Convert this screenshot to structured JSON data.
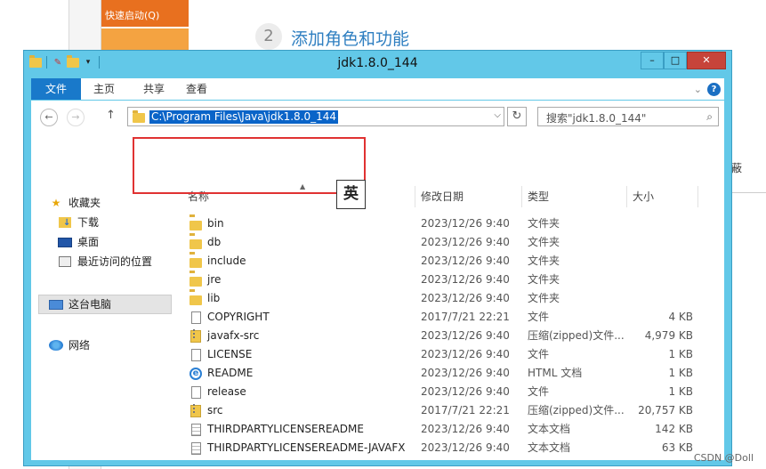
{
  "background": {
    "orange_menu": "快速启动(Q)",
    "step_number": "2",
    "step_text": "添加角色和功能",
    "right_char": "蔽",
    "watermark": "CSDN @Doll"
  },
  "window": {
    "title": "jdk1.8.0_144",
    "minimize": "–",
    "maximize": "□",
    "close": "✕"
  },
  "ribbon": {
    "tabs": [
      "文件",
      "主页",
      "共享",
      "查看"
    ],
    "help": "?"
  },
  "address": {
    "path": "C:\\Program Files\\Java\\jdk1.8.0_144",
    "search_placeholder": "搜索\"jdk1.8.0_144\""
  },
  "ime_indicator": "英",
  "nav_pane": {
    "favorites": "收藏夹",
    "downloads": "下载",
    "desktop": "桌面",
    "recent": "最近访问的位置",
    "this_pc": "这台电脑",
    "network": "网络"
  },
  "columns": {
    "name": "名称",
    "date": "修改日期",
    "type": "类型",
    "size": "大小"
  },
  "files": [
    {
      "name": "bin",
      "date": "2023/12/26 9:40",
      "type": "文件夹",
      "size": "",
      "icon": "folder-icon"
    },
    {
      "name": "db",
      "date": "2023/12/26 9:40",
      "type": "文件夹",
      "size": "",
      "icon": "folder-icon"
    },
    {
      "name": "include",
      "date": "2023/12/26 9:40",
      "type": "文件夹",
      "size": "",
      "icon": "folder-icon"
    },
    {
      "name": "jre",
      "date": "2023/12/26 9:40",
      "type": "文件夹",
      "size": "",
      "icon": "folder-icon"
    },
    {
      "name": "lib",
      "date": "2023/12/26 9:40",
      "type": "文件夹",
      "size": "",
      "icon": "folder-icon"
    },
    {
      "name": "COPYRIGHT",
      "date": "2017/7/21 22:21",
      "type": "文件",
      "size": "4 KB",
      "icon": "file-icon"
    },
    {
      "name": "javafx-src",
      "date": "2023/12/26 9:40",
      "type": "压缩(zipped)文件...",
      "size": "4,979 KB",
      "icon": "zip-icon"
    },
    {
      "name": "LICENSE",
      "date": "2023/12/26 9:40",
      "type": "文件",
      "size": "1 KB",
      "icon": "file-icon"
    },
    {
      "name": "README",
      "date": "2023/12/26 9:40",
      "type": "HTML 文档",
      "size": "1 KB",
      "icon": "html-icon"
    },
    {
      "name": "release",
      "date": "2023/12/26 9:40",
      "type": "文件",
      "size": "1 KB",
      "icon": "file-icon"
    },
    {
      "name": "src",
      "date": "2017/7/21 22:21",
      "type": "压缩(zipped)文件...",
      "size": "20,757 KB",
      "icon": "zip-icon"
    },
    {
      "name": "THIRDPARTYLICENSEREADME",
      "date": "2023/12/26 9:40",
      "type": "文本文档",
      "size": "142 KB",
      "icon": "text-file-icon"
    },
    {
      "name": "THIRDPARTYLICENSEREADME-JAVAFX",
      "date": "2023/12/26 9:40",
      "type": "文本文档",
      "size": "63 KB",
      "icon": "text-file-icon"
    }
  ],
  "colors": {
    "titlebar": "#62c8e8",
    "file_tab": "#1979ca",
    "selection": "#0a64c8",
    "highlight_box": "#e03232",
    "orange_menu": "#e8701f"
  }
}
